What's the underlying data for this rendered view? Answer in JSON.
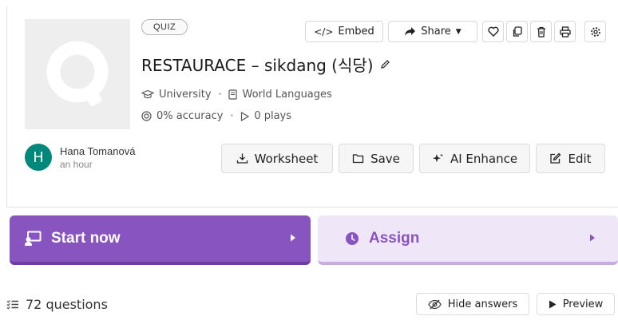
{
  "quiz": {
    "badge": "QUIZ",
    "title": "RESTAURACE – sikdang (식당)",
    "grade": "University",
    "subject": "World Languages",
    "accuracy": "0% accuracy",
    "plays": "0 plays"
  },
  "toolbar": {
    "embed_label": "Embed",
    "share_label": "Share"
  },
  "author": {
    "initial": "H",
    "name": "Hana Tomanová",
    "time": "an hour",
    "avatar_color": "#00897b"
  },
  "actions": {
    "worksheet_label": "Worksheet",
    "save_label": "Save",
    "ai_label": "AI Enhance",
    "edit_label": "Edit"
  },
  "cta": {
    "start_label": "Start now",
    "assign_label": "Assign",
    "start_color": "#8854c0",
    "assign_bg": "#efe6f7"
  },
  "footer": {
    "question_count": "72 questions",
    "hide_answers_label": "Hide answers",
    "preview_label": "Preview"
  }
}
